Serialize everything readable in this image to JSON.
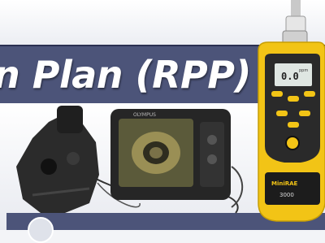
{
  "banner": {
    "title": "n Plan (RPP)"
  },
  "scope": {
    "brand": "OLYMPUS"
  },
  "monitor": {
    "reading": "0.0",
    "unit": "ppm",
    "brand": "MiniRAE",
    "sub": "3000"
  },
  "colors": {
    "banner": "#4c5479",
    "detector_body": "#f2c416",
    "detector_grip": "#2a2a2a"
  },
  "icons": [
    "borescope-illustration",
    "gas-detector-illustration"
  ]
}
